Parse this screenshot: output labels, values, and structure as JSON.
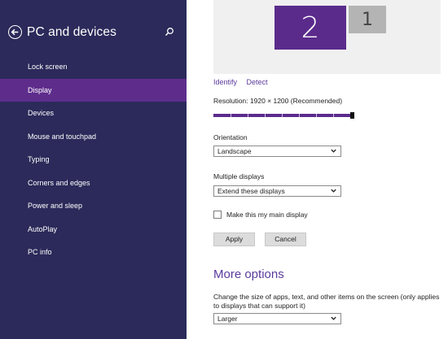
{
  "sidebar": {
    "title": "PC and devices",
    "items": [
      {
        "label": "Lock screen"
      },
      {
        "label": "Display"
      },
      {
        "label": "Devices"
      },
      {
        "label": "Mouse and touchpad"
      },
      {
        "label": "Typing"
      },
      {
        "label": "Corners and edges"
      },
      {
        "label": "Power and sleep"
      },
      {
        "label": "AutoPlay"
      },
      {
        "label": "PC info"
      }
    ],
    "selected_label": "Display"
  },
  "monitors": {
    "primary_number": "2",
    "secondary_number": "1"
  },
  "links": {
    "identify": "Identify",
    "detect": "Detect"
  },
  "resolution": {
    "label": "Resolution: 1920 × 1200 (Recommended)",
    "level": 1.0
  },
  "orientation": {
    "label": "Orientation",
    "value": "Landscape"
  },
  "multiple_displays": {
    "label": "Multiple displays",
    "value": "Extend these displays"
  },
  "main_display_checkbox": {
    "label": "Make this my main display",
    "checked": false
  },
  "buttons": {
    "apply": "Apply",
    "cancel": "Cancel"
  },
  "more_options": {
    "heading": "More options",
    "description": "Change the size of apps, text, and other items on the screen (only applies to displays that can support it)",
    "size_value": "Larger"
  },
  "colors": {
    "sidebar_bg": "#2b2a5a",
    "selected_bg": "#5e2d8c",
    "accent": "#5b2b8c",
    "link": "#5b3a9c"
  }
}
